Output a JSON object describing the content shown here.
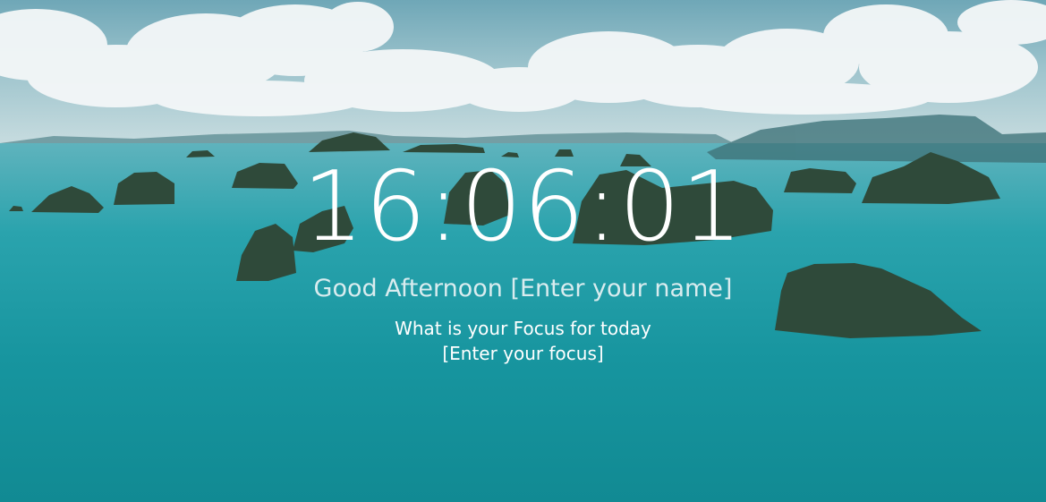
{
  "clock": {
    "time": "16:06:01"
  },
  "greeting": {
    "text": "Good Afternoon",
    "name_field": "[Enter your name]"
  },
  "focus": {
    "question": "What is your Focus for today",
    "field": "[Enter your focus]"
  },
  "colors": {
    "sea": "#1a9aa4",
    "sky": "#8cbac6",
    "text": "#ffffff",
    "greeting": "#d9ecef"
  }
}
